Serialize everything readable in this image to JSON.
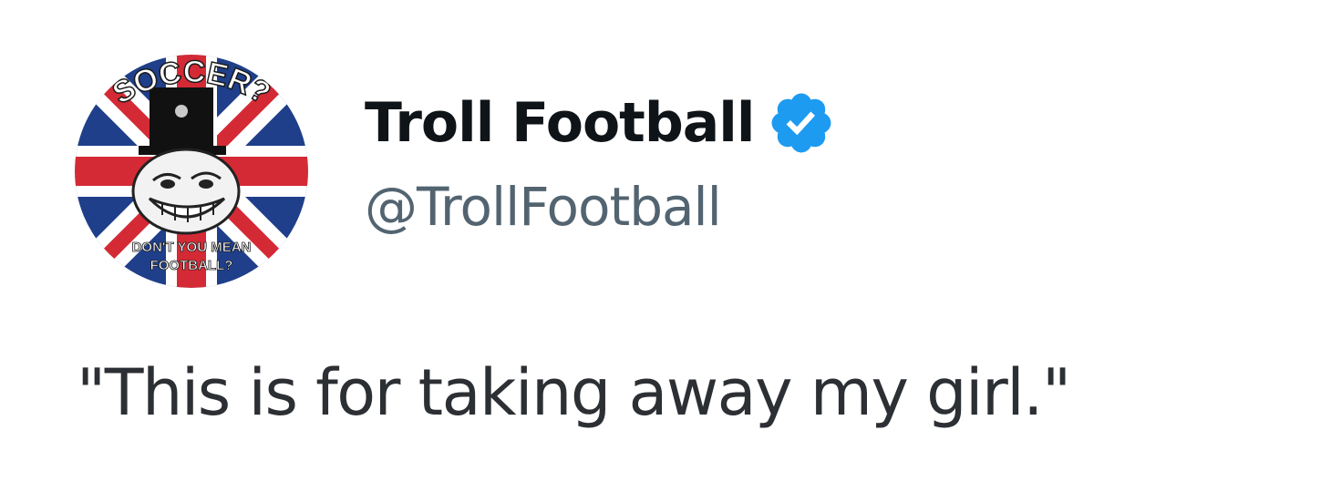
{
  "author": {
    "display_name": "Troll Football",
    "handle": "@TrollFootball",
    "verified": true,
    "verified_icon": "verified-badge-icon",
    "avatar_icon": "troll-face-union-jack-avatar",
    "avatar_text_top": "SOCCER?",
    "avatar_text_bottom_1": "DON'T YOU MEAN",
    "avatar_text_bottom_2": "FOOTBALL?"
  },
  "tweet": {
    "text": "\"This is for taking away my girl.\""
  },
  "colors": {
    "verified_blue": "#1d9bf0",
    "name": "#0f1419",
    "handle": "#536471",
    "body_text": "#2c2f33",
    "flag_blue": "#1f3f8a",
    "flag_red": "#d42a35"
  }
}
